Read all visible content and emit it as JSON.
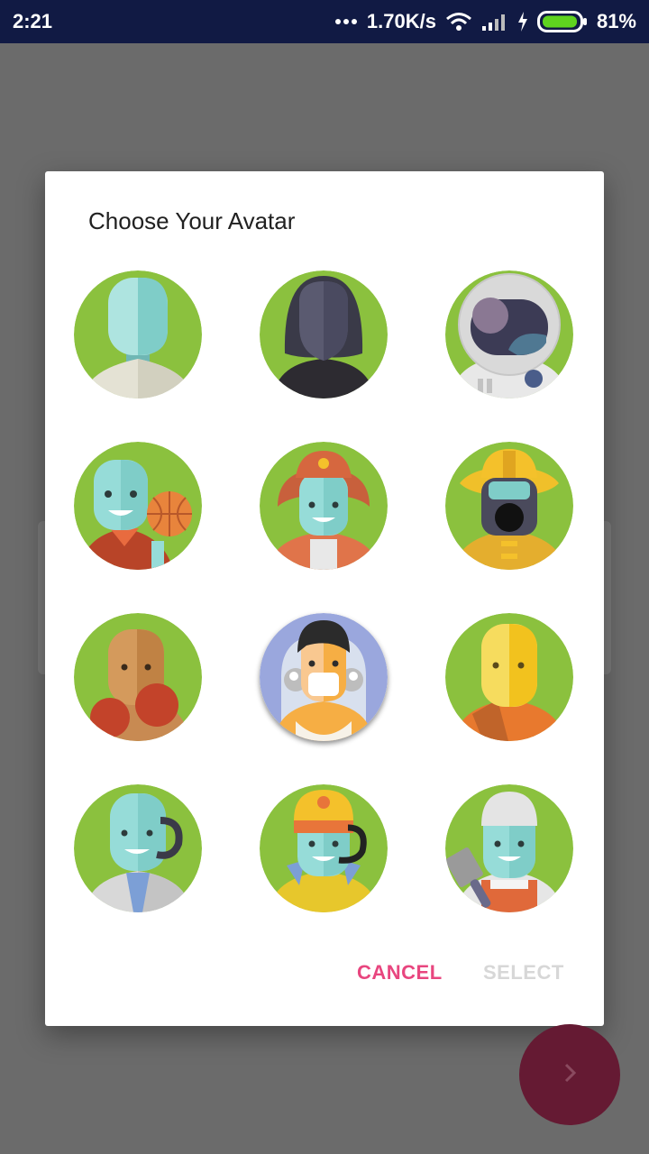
{
  "status_bar": {
    "time": "2:21",
    "speed": "1.70K/s",
    "battery": "81%"
  },
  "dialog": {
    "title": "Choose Your Avatar",
    "avatars": [
      {
        "name": "man",
        "selected": false
      },
      {
        "name": "woman",
        "selected": false
      },
      {
        "name": "astronaut",
        "selected": false
      },
      {
        "name": "basketball-player",
        "selected": false
      },
      {
        "name": "firefighter-woman",
        "selected": false
      },
      {
        "name": "firefighter-mask",
        "selected": false
      },
      {
        "name": "boxer",
        "selected": false
      },
      {
        "name": "bride",
        "selected": true
      },
      {
        "name": "yellow-man",
        "selected": false
      },
      {
        "name": "businessman-headset",
        "selected": false
      },
      {
        "name": "support-woman",
        "selected": false
      },
      {
        "name": "butcher",
        "selected": false
      }
    ],
    "cancel_label": "CANCEL",
    "select_label": "SELECT"
  },
  "colors": {
    "accent": "#e8467f",
    "avatar_bg": "#8bc13e",
    "status_bar": "#111a44",
    "fab": "#651a33",
    "disabled": "#d7d7d7"
  },
  "fab": {
    "icon": "chevron-right-icon"
  }
}
